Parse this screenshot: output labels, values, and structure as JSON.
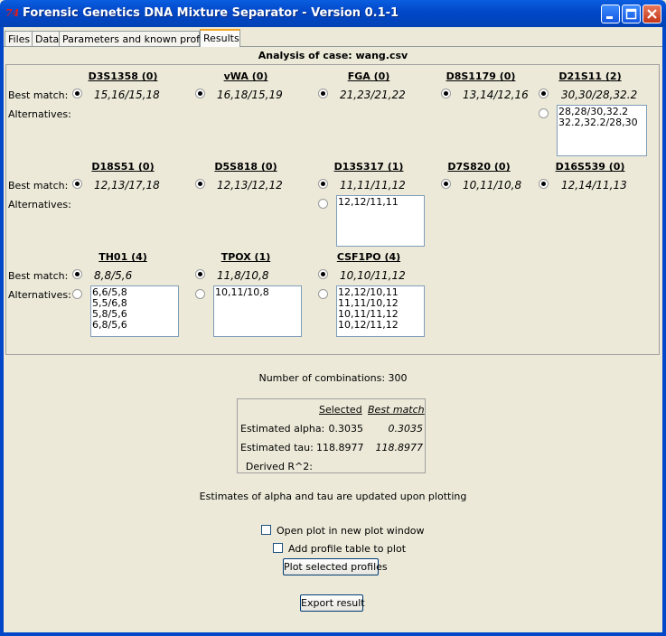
{
  "window": {
    "title": "Forensic Genetics DNA Mixture Separator - Version 0.1-1",
    "app_icon": "74"
  },
  "tabs": [
    {
      "label": "Files"
    },
    {
      "label": "Data"
    },
    {
      "label": "Parameters and known profiles"
    },
    {
      "label": "Results"
    }
  ],
  "analysis": {
    "title": "Analysis of case: wang.csv"
  },
  "labels": {
    "best_match": "Best match:",
    "alternatives": "Alternatives:"
  },
  "markers": [
    {
      "name": "D3S1358 (0)",
      "best": "15,16/15,18",
      "alternatives": []
    },
    {
      "name": "vWA (0)",
      "best": "16,18/15,19",
      "alternatives": []
    },
    {
      "name": "FGA (0)",
      "best": "21,23/21,22",
      "alternatives": []
    },
    {
      "name": "D8S1179 (0)",
      "best": "13,14/12,16",
      "alternatives": []
    },
    {
      "name": "D21S11 (2)",
      "best": "30,30/28,32.2",
      "alternatives": [
        "28,28/30,32.2",
        "32.2,32.2/28,30"
      ]
    },
    {
      "name": "D18S51 (0)",
      "best": "12,13/17,18",
      "alternatives": []
    },
    {
      "name": "D5S818 (0)",
      "best": "12,13/12,12",
      "alternatives": []
    },
    {
      "name": "D13S317 (1)",
      "best": "11,11/11,12",
      "alternatives": [
        "12,12/11,11"
      ]
    },
    {
      "name": "D7S820 (0)",
      "best": "10,11/10,8",
      "alternatives": []
    },
    {
      "name": "D16S539 (0)",
      "best": "12,14/11,13",
      "alternatives": []
    },
    {
      "name": "TH01 (4)",
      "best": "8,8/5,6",
      "alternatives": [
        "6,6/5,8",
        "5,5/6,8",
        "5,8/5,6",
        "6,8/5,6"
      ]
    },
    {
      "name": "TPOX (1)",
      "best": "11,8/10,8",
      "alternatives": [
        "10,11/10,8"
      ]
    },
    {
      "name": "CSF1PO (4)",
      "best": "10,10/11,12",
      "alternatives": [
        "12,12/10,11",
        "11,11/10,12",
        "10,11/11,12",
        "10,12/11,12"
      ]
    }
  ],
  "combinations": {
    "text": "Number of combinations: 300"
  },
  "estimates": {
    "header_selected": "Selected",
    "header_best": "Best match",
    "rows": [
      {
        "label": "Estimated alpha:",
        "selected": "0.3035",
        "best": "0.3035"
      },
      {
        "label": "Estimated tau:",
        "selected": "118.8977",
        "best": "118.8977"
      },
      {
        "label": "Derived R^2:",
        "selected": "",
        "best": ""
      }
    ],
    "note": "Estimates of alpha and tau are updated upon plotting"
  },
  "options": {
    "open_new_window": "Open plot in new plot window",
    "add_profile_table": "Add profile table to plot"
  },
  "buttons": {
    "plot": "Plot selected profiles",
    "export": "Export result"
  },
  "colors": {
    "titlebar": "#0147c8",
    "active_tab_accent": "#f5a623",
    "background": "#ece9d8"
  }
}
